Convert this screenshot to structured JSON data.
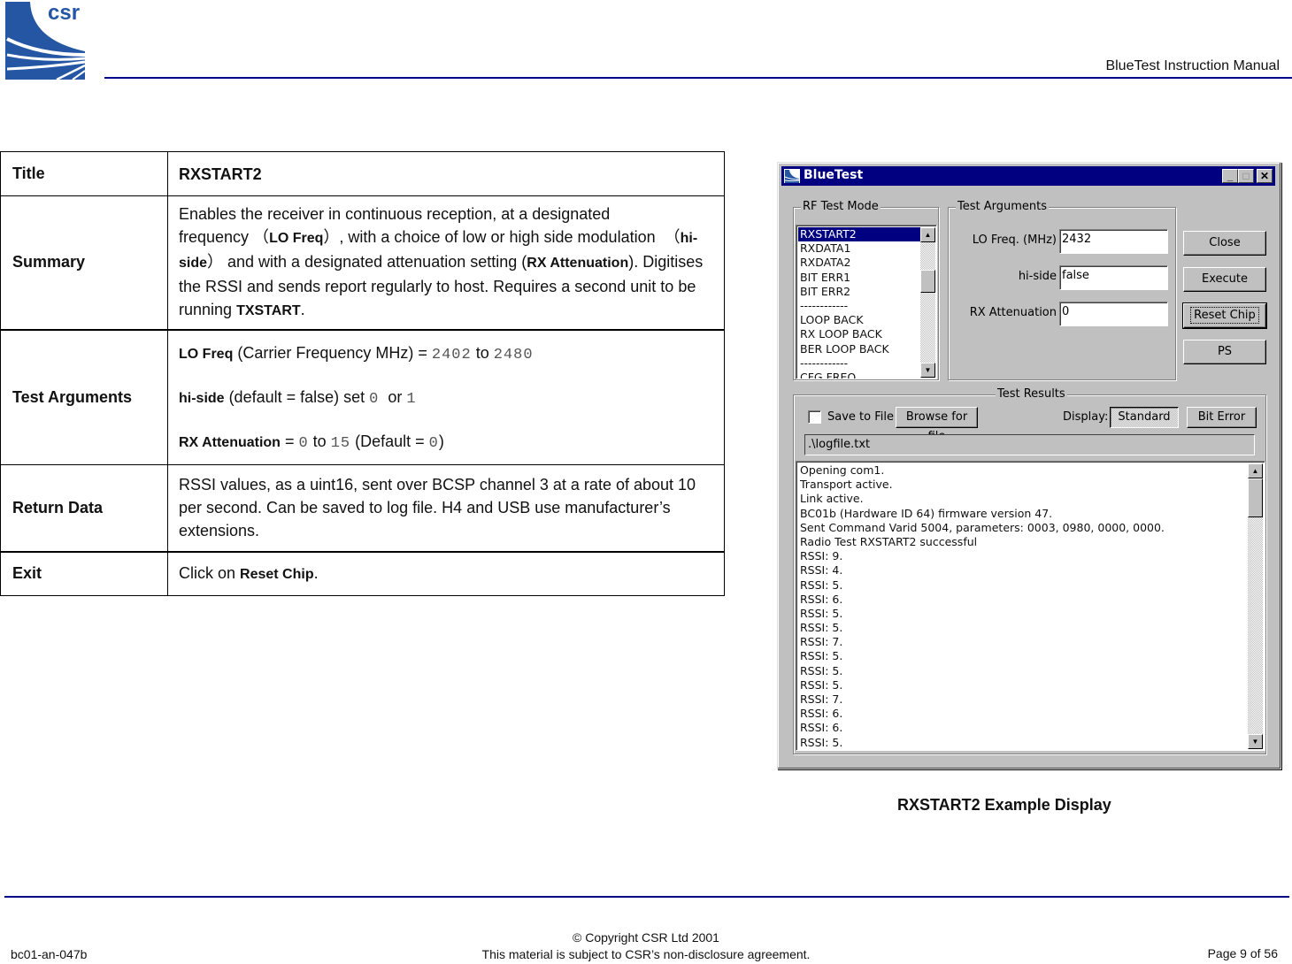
{
  "header": {
    "logo_text": "csr",
    "manual_title": "BlueTest Instruction Manual",
    "brand_color": "#00008b"
  },
  "spec_table": {
    "rows": [
      {
        "label": "Title",
        "value": "RXSTART2"
      },
      {
        "label": "Summary",
        "parts": [
          "Enables the receiver in continuous reception, at a designated frequency （",
          "LO Freq",
          "）, with a choice of low or high side modulation  （",
          "hi-side",
          "） and with a designated attenuation setting (",
          "RX Attenuation",
          "). Digitises the RSSI and sends report regularly to host. Requires a second unit to be running ",
          "TXSTART",
          "."
        ]
      },
      {
        "label": "Test Arguments",
        "args": [
          {
            "name": "LO Freq",
            "desc": " (Carrier Frequency MHz) = ",
            "v1": "2402",
            "mid": " to ",
            "v2": "2480",
            "tail": ""
          },
          {
            "name": "hi-side",
            "desc": " (default = false) set ",
            "v1": "0",
            "mid": "  or ",
            "v2": "1",
            "tail": ""
          },
          {
            "name": "RX Attenuation",
            "desc": " = ",
            "v1": "0",
            "mid": " to ",
            "v2": "15",
            "tail_pre": " (Default = ",
            "v3": "0",
            "tail": ")"
          }
        ]
      },
      {
        "label": "Return Data",
        "value": "RSSI values, as a uint16, sent over BCSP channel 3 at a rate of about 10 per second. Can be saved to log file. H4 and USB use manufacturer’s extensions."
      },
      {
        "label": "Exit",
        "prefix": "Click on ",
        "bold": "Reset Chip",
        "suffix": "."
      }
    ]
  },
  "window": {
    "title": "BlueTest",
    "controls": {
      "minimize": "_",
      "maximize": "□",
      "close": "✕"
    },
    "rf_test_mode": {
      "label": "RF Test Mode",
      "items": [
        "RXSTART2",
        "RXDATA1",
        "RXDATA2",
        "BIT ERR1",
        "BIT ERR2",
        "------------",
        "LOOP BACK",
        "RX LOOP BACK",
        "BER LOOP BACK",
        "------------",
        "CFG FREQ"
      ],
      "selected": "RXSTART2"
    },
    "test_arguments": {
      "label": "Test Arguments",
      "fields": [
        {
          "label": "LO Freq. (MHz)",
          "value": "2432"
        },
        {
          "label": "hi-side",
          "value": "false"
        },
        {
          "label": "RX Attenuation",
          "value": "0"
        }
      ]
    },
    "buttons": {
      "close": "Close",
      "execute": "Execute",
      "reset_chip": "Reset Chip",
      "ps": "PS"
    },
    "test_results": {
      "label": "Test Results",
      "save_to_file": "Save to File",
      "save_checked": false,
      "browse": "Browse for file",
      "display_label": "Display:",
      "standard": "Standard",
      "bit_error": "Bit Error",
      "display_selected": "Standard",
      "log_path": ".\\logfile.txt",
      "log_lines": [
        "Opening com1.",
        "Transport active.",
        "Link active.",
        "BC01b (Hardware ID 64) firmware version 47.",
        "Sent Command Varid 5004, parameters: 0003, 0980, 0000, 0000.",
        "Radio Test RXSTART2 successful",
        "RSSI: 9.",
        "RSSI: 4.",
        "RSSI: 5.",
        "RSSI: 6.",
        "RSSI: 5.",
        "RSSI: 5.",
        "RSSI: 7.",
        "RSSI: 5.",
        "RSSI: 5.",
        "RSSI: 5.",
        "RSSI: 7.",
        "RSSI: 6.",
        "RSSI: 6.",
        "RSSI: 5."
      ]
    }
  },
  "caption": "RXSTART2 Example Display",
  "footer": {
    "doc_id": "bc01-an-047b",
    "copyright": "© Copyright CSR Ltd 2001",
    "nda": "This material is subject to CSR’s non-disclosure agreement.",
    "page": "Page 9 of 56"
  }
}
